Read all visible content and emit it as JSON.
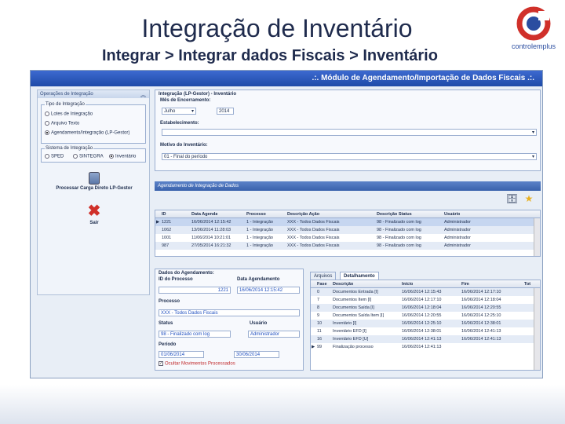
{
  "slide": {
    "title": "Integração de Inventário",
    "subtitle": "Integrar > Integrar dados Fiscais > Inventário",
    "logo_text": "controlemplus",
    "logo_colors": {
      "ring": "#d0302a",
      "inner": "#2a4da0"
    }
  },
  "app": {
    "header": ".:. Módulo de Agendamento/Importação de Dados Fiscais .:.",
    "left_panel": {
      "title": "Operações de Integração",
      "collapse_icon": "chevron-up-icon",
      "tipo_group": {
        "label": "Tipo de Integração",
        "options": [
          "Lotes de Integração",
          "Arquivo Texto",
          "Agendamento/Integração (LP-Gestor)"
        ],
        "selected_index": 2
      },
      "sistema_group": {
        "label": "Sistema de Integração",
        "options": [
          "SPED",
          "SINTEGRA",
          "Inventário"
        ],
        "selected_index": 2
      },
      "process_button": "Processar Carga Direto LP-Gestor",
      "exit_button": "Sair"
    },
    "integration_form": {
      "title": "Integração (LP-Gestor) - Inventário",
      "mes_label": "Mês de Encerramento:",
      "mes_value": "Julho",
      "ano_value": "2014",
      "estabelecimento_label": "Estabelecimento:",
      "estabelecimento_value": "",
      "motivo_label": "Motivo do Inventário:",
      "motivo_value": "01 - Final do período"
    },
    "agenda_section": "Agendamento de Integração de Dados",
    "agenda_grid": {
      "columns": [
        "ID",
        "Data Agenda",
        "Processo",
        "Descrição Ação",
        "Descrição Status",
        "Usuário"
      ],
      "rows": [
        [
          "1221",
          "16/06/2014 12:15:42",
          "1 - Integração",
          "XXX - Todos Dados Fiscais",
          "98 - Finalizado com log",
          "Administrador"
        ],
        [
          "1062",
          "13/06/2014 11:28:03",
          "1 - Integração",
          "XXX - Todos Dados Fiscais",
          "98 - Finalizado com log",
          "Administrador"
        ],
        [
          "1001",
          "11/06/2014 10:21:01",
          "1 - Integração",
          "XXX - Todos Dados Fiscais",
          "98 - Finalizado com log",
          "Administrador"
        ],
        [
          "987",
          "27/05/2014 16:21:32",
          "1 - Integração",
          "XXX - Todos Dados Fiscais",
          "98 - Finalizado com log",
          "Administrador"
        ]
      ]
    },
    "details": {
      "title": "Dados do Agendamento:",
      "id_label": "ID do Processo",
      "id_value": "1221",
      "data_label": "Data Agendamento",
      "data_value": "16/06/2014 12:15:42",
      "processo_label": "Processo",
      "processo_value": "XXX - Todos Dados Fiscais",
      "status_label": "Status",
      "status_value": "98 - Finalizado com log",
      "usuario_label": "Usuário",
      "usuario_value": "Administrador",
      "periodo_label": "Período",
      "periodo_inicio": "01/06/2014",
      "periodo_fim": "30/06/2014",
      "ocultar_label": "Ocultar Movimentos Processados"
    },
    "log_tabs": [
      "Arquivos",
      "Detalhamento"
    ],
    "log_tabs_active": 1,
    "log_grid": {
      "columns": [
        "Fase",
        "Descrição",
        "Início",
        "Fim",
        "Tot"
      ],
      "rows": [
        [
          "0",
          "Documentos Entrada [I]",
          "16/06/2014 12:15:43",
          "16/06/2014 12:17:10",
          ""
        ],
        [
          "7",
          "Documentos Item [I]",
          "16/06/2014 12:17:10",
          "16/06/2014 12:18:04",
          ""
        ],
        [
          "8",
          "Documentos Saída [I]",
          "16/06/2014 12:18:04",
          "16/06/2014 12:20:55",
          ""
        ],
        [
          "9",
          "Documentos Saída Item [I]",
          "16/06/2014 12:20:55",
          "16/06/2014 12:25:10",
          ""
        ],
        [
          "10",
          "Inventário [I]",
          "16/06/2014 12:25:10",
          "16/06/2014 12:38:01",
          ""
        ],
        [
          "11",
          "Inventário EFD [I]",
          "16/06/2014 12:38:01",
          "16/06/2014 12:41:13",
          ""
        ],
        [
          "16",
          "Inventário EFD [U]",
          "16/06/2014 12:41:13",
          "16/06/2014 12:41:13",
          ""
        ],
        [
          "99",
          "Finalização processo",
          "16/06/2014 12:41:13",
          "",
          ""
        ]
      ]
    }
  }
}
